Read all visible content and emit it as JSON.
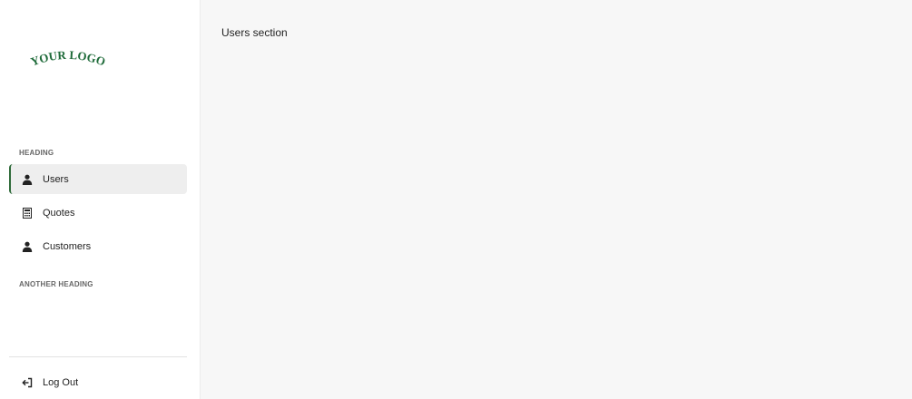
{
  "logo": {
    "text": "YOUR LOGO",
    "color": "#1f6b3a"
  },
  "sidebar": {
    "heading_1": "HEADING",
    "heading_2": "ANOTHER HEADING",
    "items": [
      {
        "label": "Users",
        "icon": "user-icon",
        "active": true
      },
      {
        "label": "Quotes",
        "icon": "calculator-icon",
        "active": false
      },
      {
        "label": "Customers",
        "icon": "user-icon",
        "active": false
      }
    ],
    "logout_label": "Log Out",
    "logout_icon": "logout-icon"
  },
  "main": {
    "section_title": "Users section"
  },
  "colors": {
    "accent": "#2f6b3a",
    "sidebar_bg": "#ffffff",
    "main_bg": "#f7f7f7",
    "active_bg": "#eeeeee"
  }
}
